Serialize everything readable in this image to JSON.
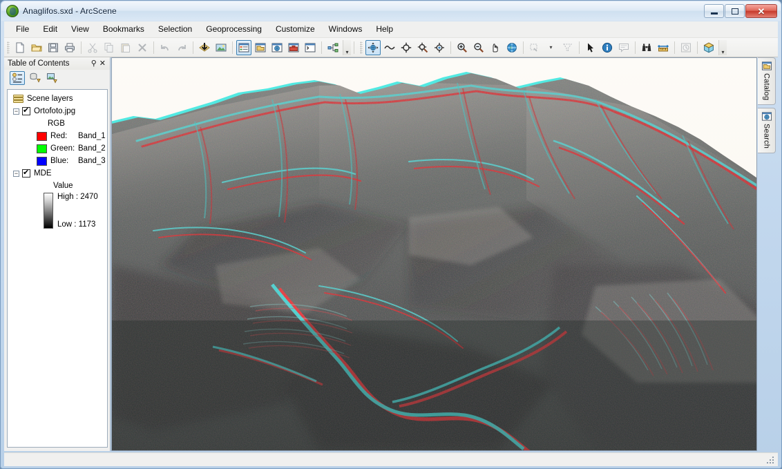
{
  "window": {
    "title": "Anaglifos.sxd - ArcScene",
    "app_icon": "arcscene-globe-icon",
    "controls": {
      "minimize": "minimize-button",
      "maximize": "restore-button",
      "close": "close-button",
      "close_glyph": "✕"
    }
  },
  "menubar": {
    "items": [
      {
        "label": "File"
      },
      {
        "label": "Edit"
      },
      {
        "label": "View"
      },
      {
        "label": "Bookmarks"
      },
      {
        "label": "Selection"
      },
      {
        "label": "Geoprocessing"
      },
      {
        "label": "Customize"
      },
      {
        "label": "Windows"
      },
      {
        "label": "Help"
      }
    ]
  },
  "toolbar": {
    "buttons": [
      {
        "name": "new-document-button",
        "icon": "new-document-icon",
        "state": "enabled"
      },
      {
        "name": "open-document-button",
        "icon": "open-folder-icon",
        "state": "enabled"
      },
      {
        "name": "save-button",
        "icon": "floppy-disk-icon",
        "state": "enabled"
      },
      {
        "name": "print-button",
        "icon": "printer-icon",
        "state": "enabled"
      },
      {
        "name": "cut-button",
        "icon": "scissors-icon",
        "state": "disabled"
      },
      {
        "name": "copy-button",
        "icon": "copy-icon",
        "state": "disabled"
      },
      {
        "name": "paste-button",
        "icon": "paste-icon",
        "state": "disabled"
      },
      {
        "name": "delete-button",
        "icon": "x-delete-icon",
        "state": "disabled"
      },
      {
        "name": "undo-button",
        "icon": "undo-arrow-icon",
        "state": "disabled"
      },
      {
        "name": "redo-button",
        "icon": "redo-arrow-icon",
        "state": "disabled"
      },
      {
        "name": "add-data-button",
        "icon": "add-data-icon",
        "state": "enabled"
      },
      {
        "name": "scene-properties-button",
        "icon": "image-layer-icon",
        "state": "enabled"
      },
      {
        "name": "toggle-table-of-contents-button",
        "icon": "table-of-contents-icon",
        "state": "active"
      },
      {
        "name": "catalog-window-button",
        "icon": "catalog-icon",
        "state": "enabled"
      },
      {
        "name": "search-window-button",
        "icon": "search-window-icon",
        "state": "enabled"
      },
      {
        "name": "arctoolbox-button",
        "icon": "toolbox-icon",
        "state": "enabled"
      },
      {
        "name": "python-window-button",
        "icon": "python-console-icon",
        "state": "enabled"
      },
      {
        "name": "model-builder-button",
        "icon": "model-builder-icon",
        "state": "enabled"
      },
      {
        "name": "navigate-button",
        "icon": "navigate-globe-icon",
        "state": "active"
      },
      {
        "name": "fly-button",
        "icon": "fly-bird-icon",
        "state": "enabled"
      },
      {
        "name": "center-on-target-button",
        "icon": "center-target-icon",
        "state": "enabled"
      },
      {
        "name": "zoom-to-target-button",
        "icon": "zoom-target-icon",
        "state": "enabled"
      },
      {
        "name": "set-observer-button",
        "icon": "observer-target-icon",
        "state": "enabled"
      },
      {
        "name": "zoom-in-button",
        "icon": "zoom-in-icon",
        "state": "enabled"
      },
      {
        "name": "zoom-out-button",
        "icon": "zoom-out-icon",
        "state": "enabled"
      },
      {
        "name": "pan-button",
        "icon": "hand-pan-icon",
        "state": "enabled"
      },
      {
        "name": "full-extent-button",
        "icon": "globe-full-extent-icon",
        "state": "enabled"
      },
      {
        "name": "zoom-to-selection-button",
        "icon": "zoom-selection-icon",
        "state": "disabled"
      },
      {
        "name": "clear-selection-button",
        "icon": "clear-selection-icon",
        "state": "disabled"
      },
      {
        "name": "select-features-button",
        "icon": "arrow-pointer-icon",
        "state": "enabled"
      },
      {
        "name": "identify-button",
        "icon": "identify-info-icon",
        "state": "enabled"
      },
      {
        "name": "html-popup-button",
        "icon": "html-popup-icon",
        "state": "enabled"
      },
      {
        "name": "find-button",
        "icon": "binoculars-icon",
        "state": "enabled"
      },
      {
        "name": "measure-button",
        "icon": "measure-ruler-icon",
        "state": "enabled"
      },
      {
        "name": "time-slider-button",
        "icon": "clock-time-icon",
        "state": "disabled"
      },
      {
        "name": "3d-effects-button",
        "icon": "3d-cube-icon",
        "state": "enabled"
      }
    ],
    "overflow_glyph": "▾"
  },
  "table_of_contents": {
    "title": "Table of Contents",
    "pin_glyph": "⚲",
    "close_glyph": "✕",
    "view_buttons": [
      {
        "name": "list-by-drawing-order-button",
        "label": "List By Drawing Order",
        "selected": true
      },
      {
        "name": "list-by-source-button",
        "label": "List By Source",
        "selected": false
      },
      {
        "name": "list-by-visibility-button",
        "label": "List By Visibility",
        "selected": false
      }
    ],
    "root": {
      "label": "Scene layers"
    },
    "layers": [
      {
        "name": "Ortofoto.jpg",
        "checked": true,
        "expanded": true,
        "renderer_label": "RGB",
        "bands": [
          {
            "channel": "Red:",
            "band": "Band_1",
            "color": "#ff0000"
          },
          {
            "channel": "Green:",
            "band": "Band_2",
            "color": "#00ff00"
          },
          {
            "channel": "Blue:",
            "band": "Band_3",
            "color": "#0000ff"
          }
        ]
      },
      {
        "name": "MDE",
        "checked": true,
        "expanded": true,
        "value_label": "Value",
        "high_label": "High : 2470",
        "low_label": "Low : 1173",
        "ramp_top_color": "#ffffff",
        "ramp_bottom_color": "#000000"
      }
    ]
  },
  "scene_view": {
    "name": "3d-scene-view",
    "description": "Red-cyan anaglyph 3D terrain rendering of a mountainous landscape draped with orthophoto imagery",
    "background_color": "#fbf7f1",
    "anaglyph_left_color": "#ff0000",
    "anaglyph_right_color": "#00ffff"
  },
  "right_dock": {
    "tabs": [
      {
        "label": "Catalog",
        "icon": "catalog-icon"
      },
      {
        "label": "Search",
        "icon": "search-globe-icon"
      }
    ]
  },
  "statusbar": {
    "text": "",
    "resize_grip": "resize-grip"
  }
}
